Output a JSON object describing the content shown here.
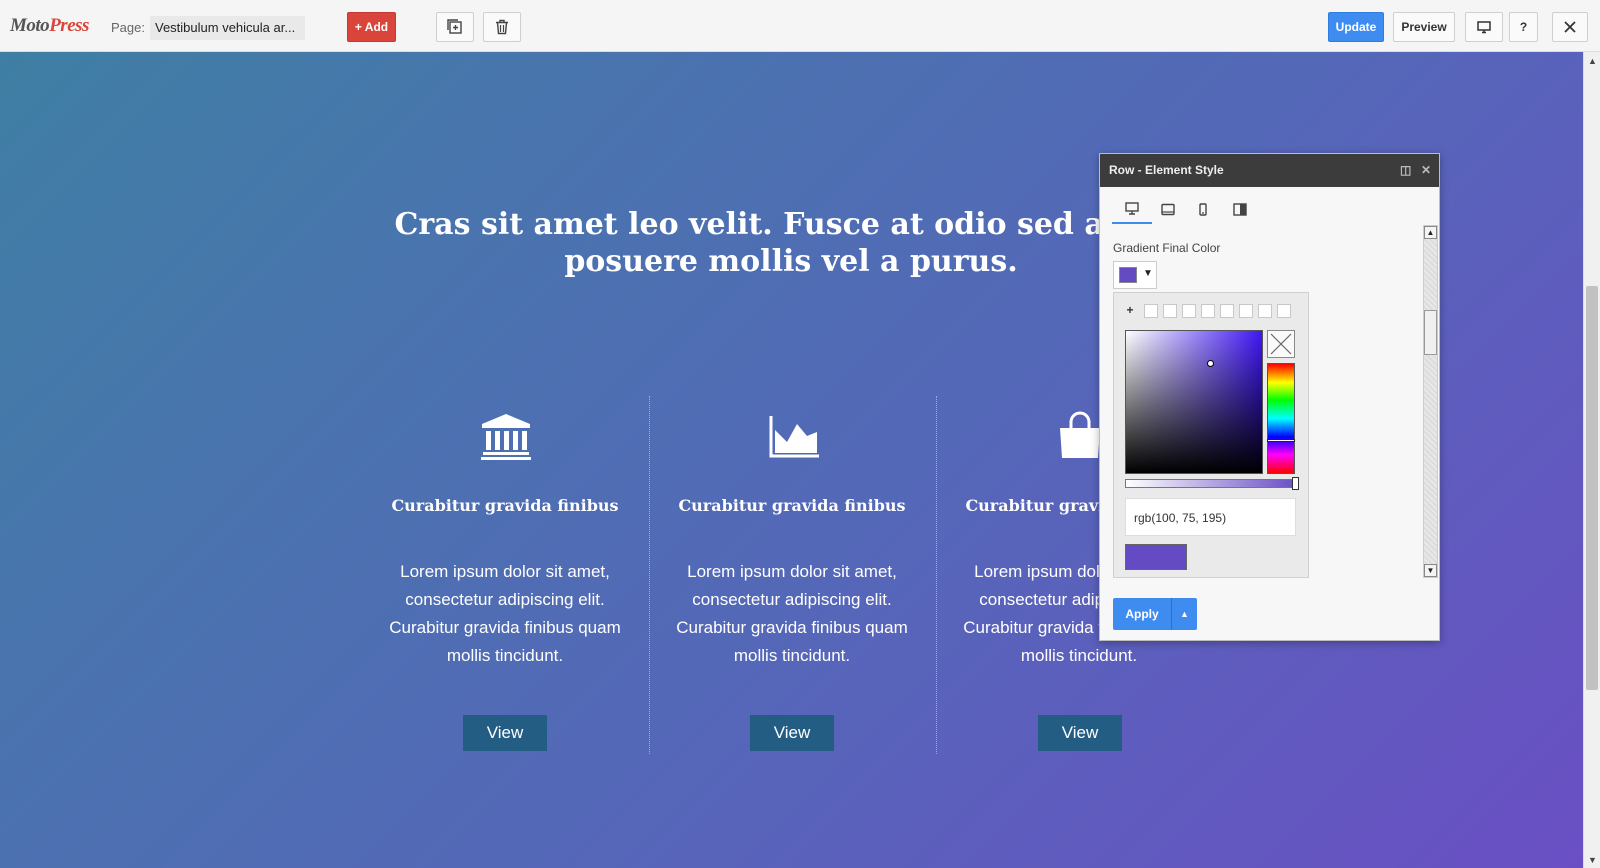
{
  "toolbar": {
    "logo_main": "Moto",
    "logo_accent": "Press",
    "page_label": "Page:",
    "page_name": "Vestibulum vehicula ar...",
    "add_label": "+ Add",
    "update_label": "Update",
    "preview_label": "Preview",
    "help_label": "?",
    "icons": [
      "duplicate-icon",
      "trash-icon",
      "desktop-icon",
      "close-icon"
    ]
  },
  "main": {
    "headline": "Cras sit amet leo velit. Fusce at odio sed augue posuere mollis vel a purus.",
    "columns": [
      {
        "icon": "bank-icon",
        "title": "Curabitur gravida finibus",
        "text": "Lorem ipsum dolor sit amet, consectetur adipiscing elit. Curabitur gravida finibus quam mollis tincidunt.",
        "button": "View"
      },
      {
        "icon": "area-chart-icon",
        "title": "Curabitur gravida finibus",
        "text": "Lorem ipsum dolor sit amet, consectetur adipiscing elit. Curabitur gravida finibus quam mollis tincidunt.",
        "button": "View"
      },
      {
        "icon": "shopping-bag-icon",
        "title": "Curabitur gravida finibus",
        "text": "Lorem ipsum dolor sit amet, consectetur adipiscing elit. Curabitur gravida finibus quam mollis tincidunt.",
        "button": "View"
      }
    ]
  },
  "panel": {
    "title": "Row - Element Style",
    "device_tabs": [
      "desktop",
      "tablet-landscape",
      "tablet-portrait",
      "mobile"
    ],
    "active_tab": "desktop",
    "field_label": "Gradient Final Color",
    "color_value": "rgb(100, 75, 195)",
    "selected_color": "#644bc3",
    "apply_label": "Apply"
  },
  "colors": {
    "accent_blue": "#3f8cf1",
    "add_red": "#d9453a",
    "view_button": "#245d84"
  }
}
